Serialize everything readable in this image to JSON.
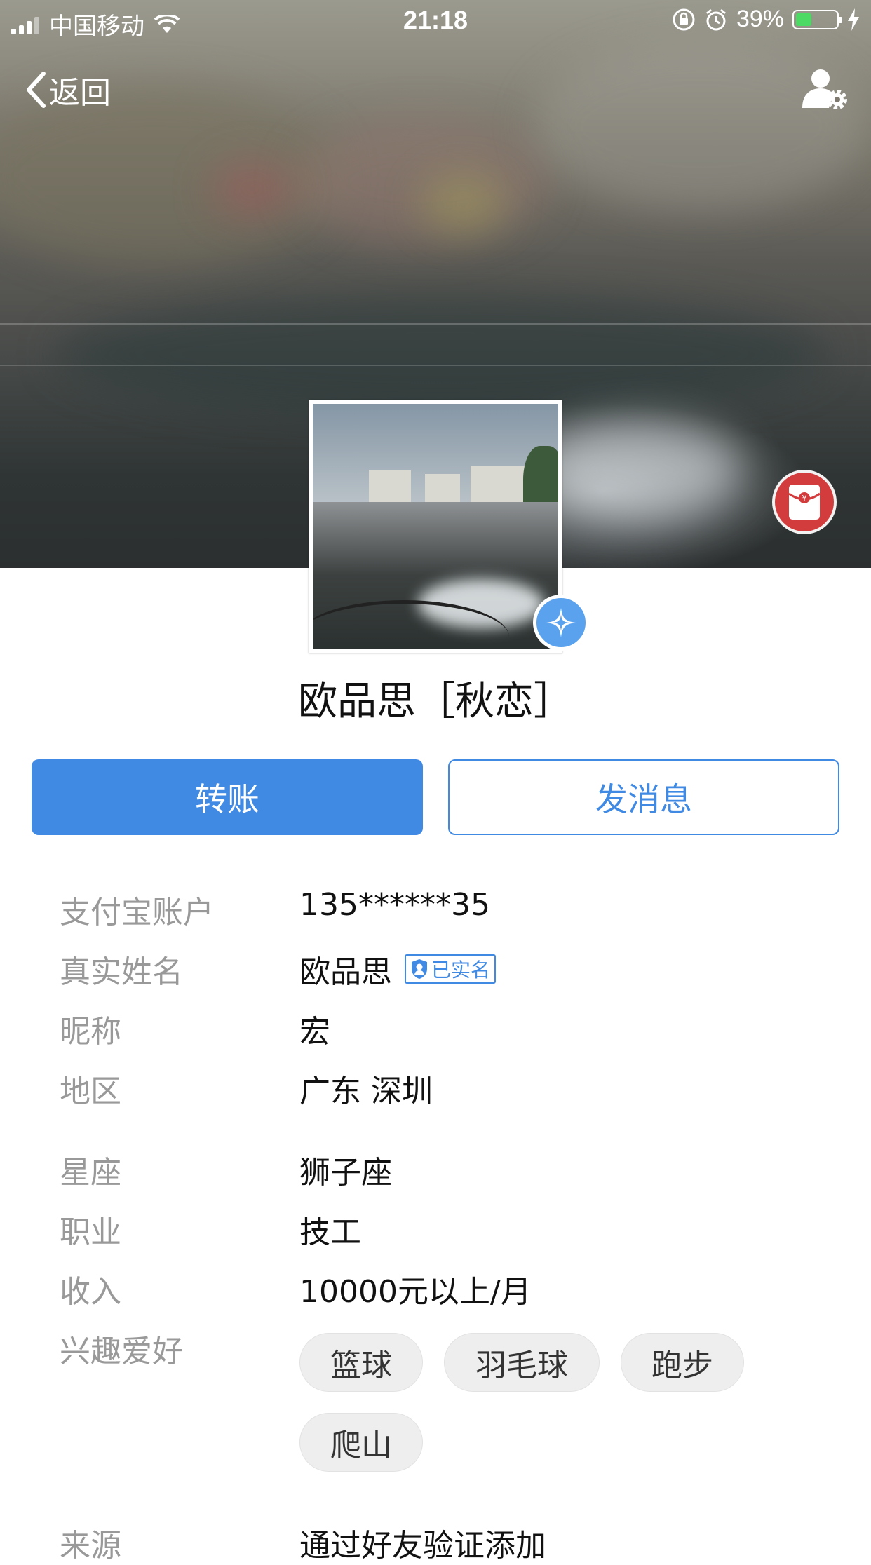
{
  "status_bar": {
    "carrier": "中国移动",
    "time": "21:18",
    "battery_percent": "39%",
    "battery_level": 0.39,
    "colors": {
      "battery_fill": "#4cd964"
    }
  },
  "nav": {
    "back_label": "返回",
    "back_icon": "chevron-left-icon",
    "settings_icon": "user-settings-icon"
  },
  "profile": {
    "display_name": "欧品思［秋恋］",
    "red_packet_icon": "red-packet-icon",
    "badge_icon": "star-badge-icon"
  },
  "actions": {
    "transfer_label": "转账",
    "message_label": "发消息",
    "colors": {
      "primary": "#418ae3"
    }
  },
  "info": {
    "account": {
      "label": "支付宝账户",
      "value": "135******35"
    },
    "real_name": {
      "label": "真实姓名",
      "value": "欧品思",
      "verified_label": "已实名"
    },
    "nickname": {
      "label": "昵称",
      "value": "宏"
    },
    "region": {
      "label": "地区",
      "value": "广东 深圳"
    },
    "zodiac": {
      "label": "星座",
      "value": "狮子座"
    },
    "job": {
      "label": "职业",
      "value": "技工"
    },
    "income": {
      "label": "收入",
      "value": "10000元以上/月"
    },
    "hobbies": {
      "label": "兴趣爱好",
      "tags": [
        "篮球",
        "羽毛球",
        "跑步",
        "爬山"
      ]
    },
    "source": {
      "label": "来源",
      "value": "通过好友验证添加"
    }
  }
}
